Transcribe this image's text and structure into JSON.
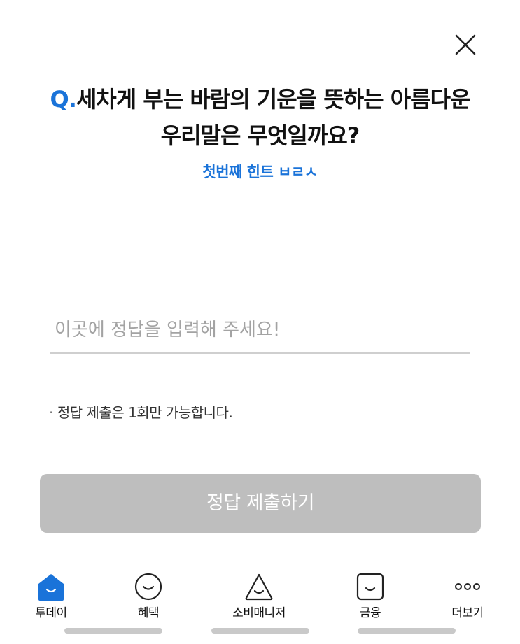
{
  "quiz": {
    "question_prefix": "Q.",
    "question_line1": "세차게 부는 바람의 기운을 뜻하는 아름다운",
    "question_line2": "우리말은 무엇일까요?",
    "hint": "첫번째 힌트 ㅂㄹㅅ",
    "answer_placeholder": "이곳에 정답을 입력해 주세요!",
    "answer_value": "",
    "notice_bullet": "·",
    "notice": "정답 제출은 1회만 가능합니다.",
    "submit_label": "정답 제출하기"
  },
  "colors": {
    "accent": "#1a73d9",
    "submit_disabled": "#bebebe"
  },
  "tabbar": {
    "items": [
      {
        "label": "투데이",
        "icon": "today-home-icon",
        "active": true
      },
      {
        "label": "혜택",
        "icon": "smile-circle-icon",
        "active": false
      },
      {
        "label": "소비매니저",
        "icon": "smile-triangle-icon",
        "active": false
      },
      {
        "label": "금융",
        "icon": "smile-square-icon",
        "active": false
      },
      {
        "label": "더보기",
        "icon": "more-dots-icon",
        "active": false
      }
    ]
  }
}
